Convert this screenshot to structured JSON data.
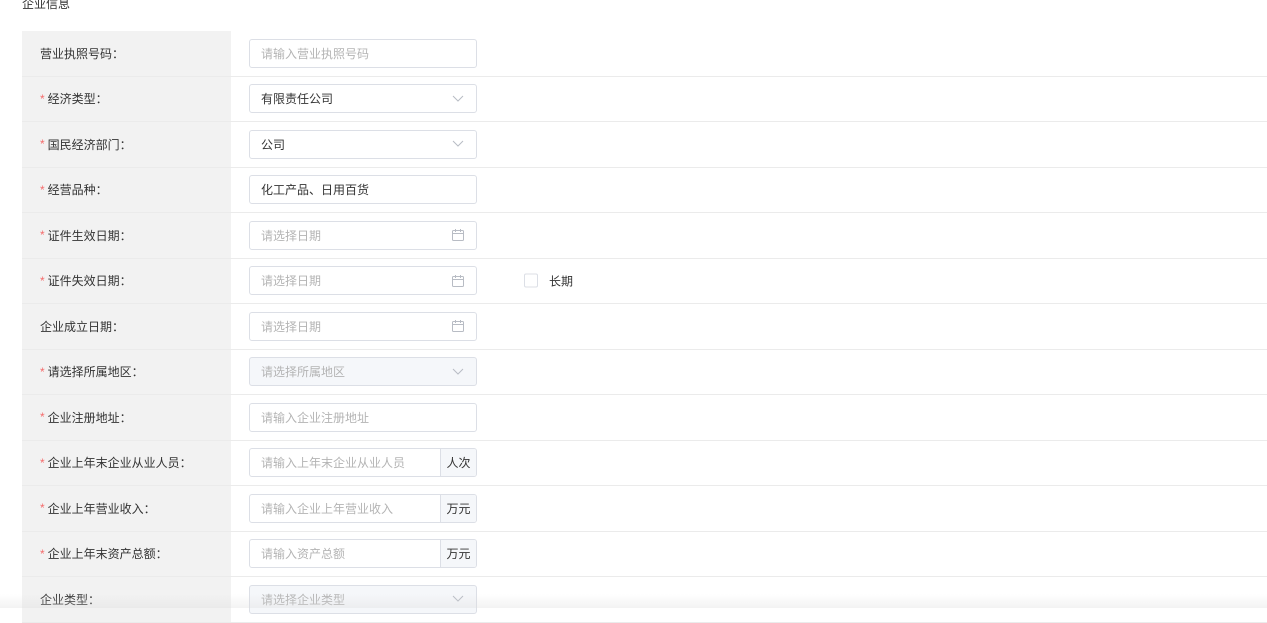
{
  "section_title": "企业信息",
  "rows": [
    {
      "label": "营业执照号码：",
      "required": false,
      "type": "text",
      "placeholder": "请输入营业执照号码",
      "value": ""
    },
    {
      "label": "经济类型：",
      "required": true,
      "type": "select",
      "placeholder": "",
      "value": "有限责任公司"
    },
    {
      "label": "国民经济部门：",
      "required": true,
      "type": "select",
      "placeholder": "",
      "value": "公司"
    },
    {
      "label": "经营品种：",
      "required": true,
      "type": "text",
      "placeholder": "",
      "value": "化工产品、日用百货"
    },
    {
      "label": "证件生效日期：",
      "required": true,
      "type": "date",
      "placeholder": "请选择日期",
      "value": ""
    },
    {
      "label": "证件失效日期：",
      "required": true,
      "type": "date",
      "placeholder": "请选择日期",
      "value": "",
      "checkbox_label": "长期",
      "checked": false
    },
    {
      "label": "企业成立日期：",
      "required": false,
      "type": "date",
      "placeholder": "请选择日期",
      "value": ""
    },
    {
      "label": "请选择所属地区：",
      "required": true,
      "type": "select",
      "disabled": true,
      "placeholder": "请选择所属地区",
      "value": ""
    },
    {
      "label": "企业注册地址：",
      "required": true,
      "type": "text",
      "placeholder": "请输入企业注册地址",
      "value": ""
    },
    {
      "label": "企业上年末企业从业人员：",
      "required": true,
      "type": "append",
      "placeholder": "请输入上年末企业从业人员",
      "value": "",
      "append": "人次"
    },
    {
      "label": "企业上年营业收入：",
      "required": true,
      "type": "append",
      "placeholder": "请输入企业上年营业收入",
      "value": "",
      "append": "万元"
    },
    {
      "label": "企业上年末资产总额：",
      "required": true,
      "type": "append",
      "placeholder": "请输入资产总额",
      "value": "",
      "append": "万元"
    },
    {
      "label": "企业类型：",
      "required": false,
      "type": "select",
      "disabled": true,
      "placeholder": "请选择企业类型",
      "value": ""
    }
  ],
  "required_mark": "*",
  "colors": {
    "label_bg": "#f2f2f2",
    "required": "#f56c6c",
    "border": "#dcdfe6",
    "placeholder": "#b4b4b4"
  },
  "icons": {
    "select": "chevron-down-icon",
    "date": "calendar-icon"
  }
}
